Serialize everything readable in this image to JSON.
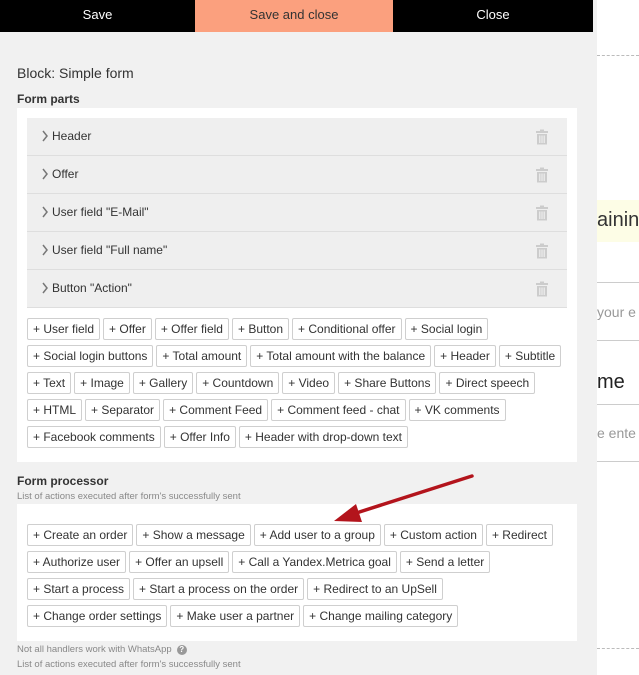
{
  "topbar": {
    "save": "Save",
    "save_close": "Save and close",
    "close": "Close"
  },
  "block_title": "Block: Simple form",
  "form_parts": {
    "title": "Form parts",
    "items": [
      "Header",
      "Offer",
      "User field \"E-Mail\"",
      "User field \"Full name\"",
      "Button \"Action\""
    ],
    "add_buttons": [
      "+ User field",
      "+ Offer",
      "+ Offer field",
      "+ Button",
      "+ Conditional offer",
      "+ Social login",
      "+ Social login buttons",
      "+ Total amount",
      "+ Total amount with the balance",
      "+ Header",
      "+ Subtitle",
      "+ Text",
      "+ Image",
      "+ Gallery",
      "+ Countdown",
      "+ Video",
      "+ Share Buttons",
      "+ Direct speech",
      "+ HTML",
      "+ Separator",
      "+ Comment Feed",
      "+ Comment feed - chat",
      "+ VK comments",
      "+ Facebook comments",
      "+ Offer Info",
      "+ Header with drop-down text"
    ]
  },
  "form_processor": {
    "title": "Form processor",
    "subtitle": "List of actions executed after form's successfully sent",
    "add_buttons": [
      "+ Create an order",
      "+ Show a message",
      "+ Add user to a group",
      "+ Custom action",
      "+ Redirect",
      "+ Authorize user",
      "+ Offer an upsell",
      "+ Call a Yandex.Metrica goal",
      "+ Send a letter",
      "+ Start a process",
      "+ Start a process on the order",
      "+ Redirect to an UpSell",
      "+ Change order settings",
      "+ Make user a partner",
      "+ Change mailing category"
    ],
    "note": "Not all handlers work with WhatsApp",
    "note2": "List of actions executed after form's successfully sent"
  },
  "background_page": {
    "t1": "aining",
    "t2": "your e",
    "t3": "me",
    "t4": "e ente"
  },
  "colors": {
    "accent": "#fba07e",
    "arrow": "#b3141c"
  }
}
